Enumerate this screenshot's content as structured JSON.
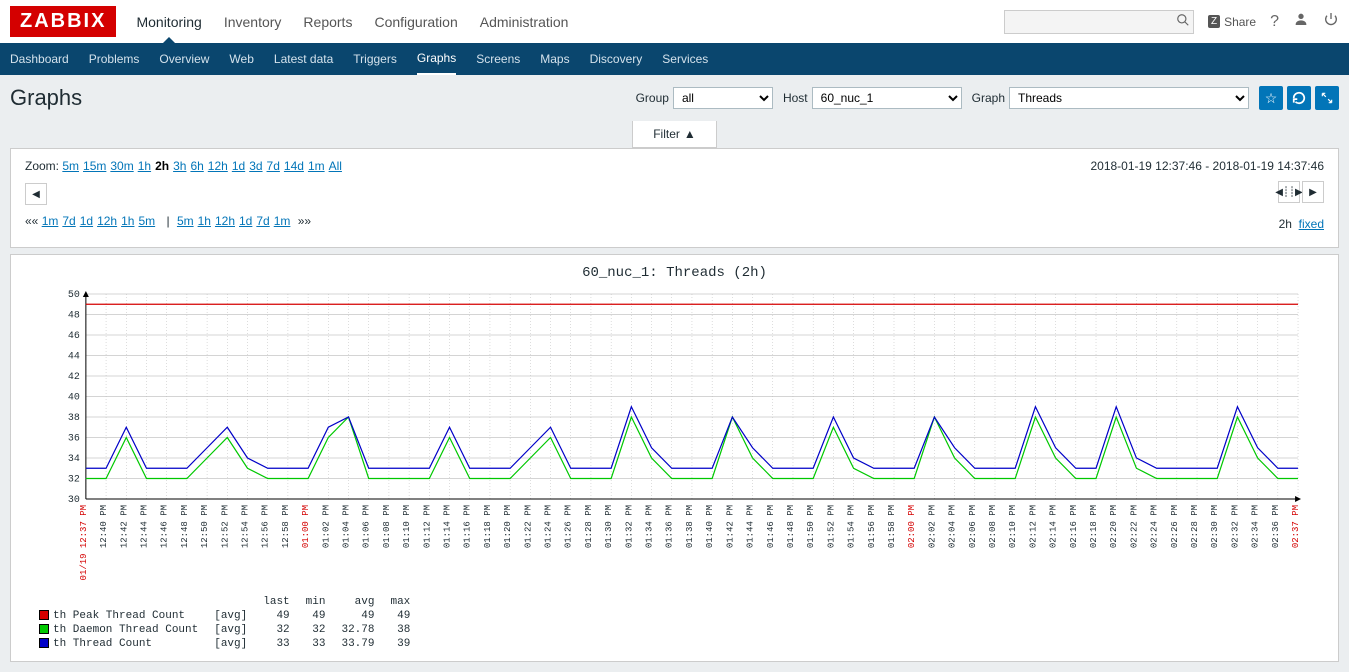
{
  "header": {
    "logo": "ZABBIX",
    "nav": [
      "Monitoring",
      "Inventory",
      "Reports",
      "Configuration",
      "Administration"
    ],
    "nav_active": 0,
    "share": "Share",
    "search_placeholder": ""
  },
  "subnav": {
    "items": [
      "Dashboard",
      "Problems",
      "Overview",
      "Web",
      "Latest data",
      "Triggers",
      "Graphs",
      "Screens",
      "Maps",
      "Discovery",
      "Services"
    ],
    "active": 6
  },
  "page": {
    "title": "Graphs",
    "group_label": "Group",
    "group_value": "all",
    "host_label": "Host",
    "host_value": "60_nuc_1",
    "graph_label": "Graph",
    "graph_value": "Threads",
    "filter_label": "Filter"
  },
  "time": {
    "zoom_label": "Zoom:",
    "zoom_options": [
      "5m",
      "15m",
      "30m",
      "1h",
      "2h",
      "3h",
      "6h",
      "12h",
      "1d",
      "3d",
      "7d",
      "14d",
      "1m",
      "All"
    ],
    "zoom_active": 4,
    "range_text": "2018-01-19 12:37:46 - 2018-01-19 14:37:46",
    "back_prefix": "««",
    "back_options": [
      "1m",
      "7d",
      "1d",
      "12h",
      "1h",
      "5m"
    ],
    "fwd_options": [
      "5m",
      "1h",
      "12h",
      "1d",
      "7d",
      "1m"
    ],
    "fwd_suffix": "»»",
    "duration": "2h",
    "fixed": "fixed"
  },
  "chart_data": {
    "type": "line",
    "title": "60_nuc_1: Threads (2h)",
    "ylim": [
      30,
      50
    ],
    "y_ticks": [
      30,
      32,
      34,
      36,
      38,
      40,
      42,
      44,
      46,
      48,
      50
    ],
    "x_labels": [
      "01/19 12:37 PM",
      "12:40 PM",
      "12:42 PM",
      "12:44 PM",
      "12:46 PM",
      "12:48 PM",
      "12:50 PM",
      "12:52 PM",
      "12:54 PM",
      "12:56 PM",
      "12:58 PM",
      "01:00 PM",
      "01:02 PM",
      "01:04 PM",
      "01:06 PM",
      "01:08 PM",
      "01:10 PM",
      "01:12 PM",
      "01:14 PM",
      "01:16 PM",
      "01:18 PM",
      "01:20 PM",
      "01:22 PM",
      "01:24 PM",
      "01:26 PM",
      "01:28 PM",
      "01:30 PM",
      "01:32 PM",
      "01:34 PM",
      "01:36 PM",
      "01:38 PM",
      "01:40 PM",
      "01:42 PM",
      "01:44 PM",
      "01:46 PM",
      "01:48 PM",
      "01:50 PM",
      "01:52 PM",
      "01:54 PM",
      "01:56 PM",
      "01:58 PM",
      "02:00 PM",
      "02:02 PM",
      "02:04 PM",
      "02:06 PM",
      "02:08 PM",
      "02:10 PM",
      "02:12 PM",
      "02:14 PM",
      "02:16 PM",
      "02:18 PM",
      "02:20 PM",
      "02:22 PM",
      "02:24 PM",
      "02:26 PM",
      "02:28 PM",
      "02:30 PM",
      "02:32 PM",
      "02:34 PM",
      "02:36 PM",
      "02:37 PM"
    ],
    "x_red_indices": [
      0,
      11,
      41,
      60
    ],
    "series": [
      {
        "name": "th Peak Thread Count",
        "color": "#d40000",
        "agg": "[avg]",
        "last": 49,
        "min": 49,
        "avg": 49,
        "max": 49,
        "values": [
          49,
          49,
          49,
          49,
          49,
          49,
          49,
          49,
          49,
          49,
          49,
          49,
          49,
          49,
          49,
          49,
          49,
          49,
          49,
          49,
          49,
          49,
          49,
          49,
          49,
          49,
          49,
          49,
          49,
          49,
          49,
          49,
          49,
          49,
          49,
          49,
          49,
          49,
          49,
          49,
          49,
          49,
          49,
          49,
          49,
          49,
          49,
          49,
          49,
          49,
          49,
          49,
          49,
          49,
          49,
          49,
          49,
          49,
          49,
          49,
          49
        ]
      },
      {
        "name": "th Daemon Thread Count",
        "color": "#00c800",
        "agg": "[avg]",
        "last": 32,
        "min": 32,
        "avg": 32.78,
        "max": 38,
        "values": [
          32,
          32,
          36,
          32,
          32,
          32,
          34,
          36,
          33,
          32,
          32,
          32,
          36,
          38,
          32,
          32,
          32,
          32,
          36,
          32,
          32,
          32,
          34,
          36,
          32,
          32,
          32,
          38,
          34,
          32,
          32,
          32,
          38,
          34,
          32,
          32,
          32,
          37,
          33,
          32,
          32,
          32,
          38,
          34,
          32,
          32,
          32,
          38,
          34,
          32,
          32,
          38,
          33,
          32,
          32,
          32,
          32,
          38,
          34,
          32,
          32
        ]
      },
      {
        "name": "th Thread Count",
        "color": "#0000c8",
        "agg": "[avg]",
        "last": 33,
        "min": 33,
        "avg": 33.79,
        "max": 39,
        "values": [
          33,
          33,
          37,
          33,
          33,
          33,
          35,
          37,
          34,
          33,
          33,
          33,
          37,
          38,
          33,
          33,
          33,
          33,
          37,
          33,
          33,
          33,
          35,
          37,
          33,
          33,
          33,
          39,
          35,
          33,
          33,
          33,
          38,
          35,
          33,
          33,
          33,
          38,
          34,
          33,
          33,
          33,
          38,
          35,
          33,
          33,
          33,
          39,
          35,
          33,
          33,
          39,
          34,
          33,
          33,
          33,
          33,
          39,
          35,
          33,
          33
        ]
      }
    ],
    "legend_headers": [
      "",
      "",
      "last",
      "min",
      "avg",
      "max"
    ]
  }
}
